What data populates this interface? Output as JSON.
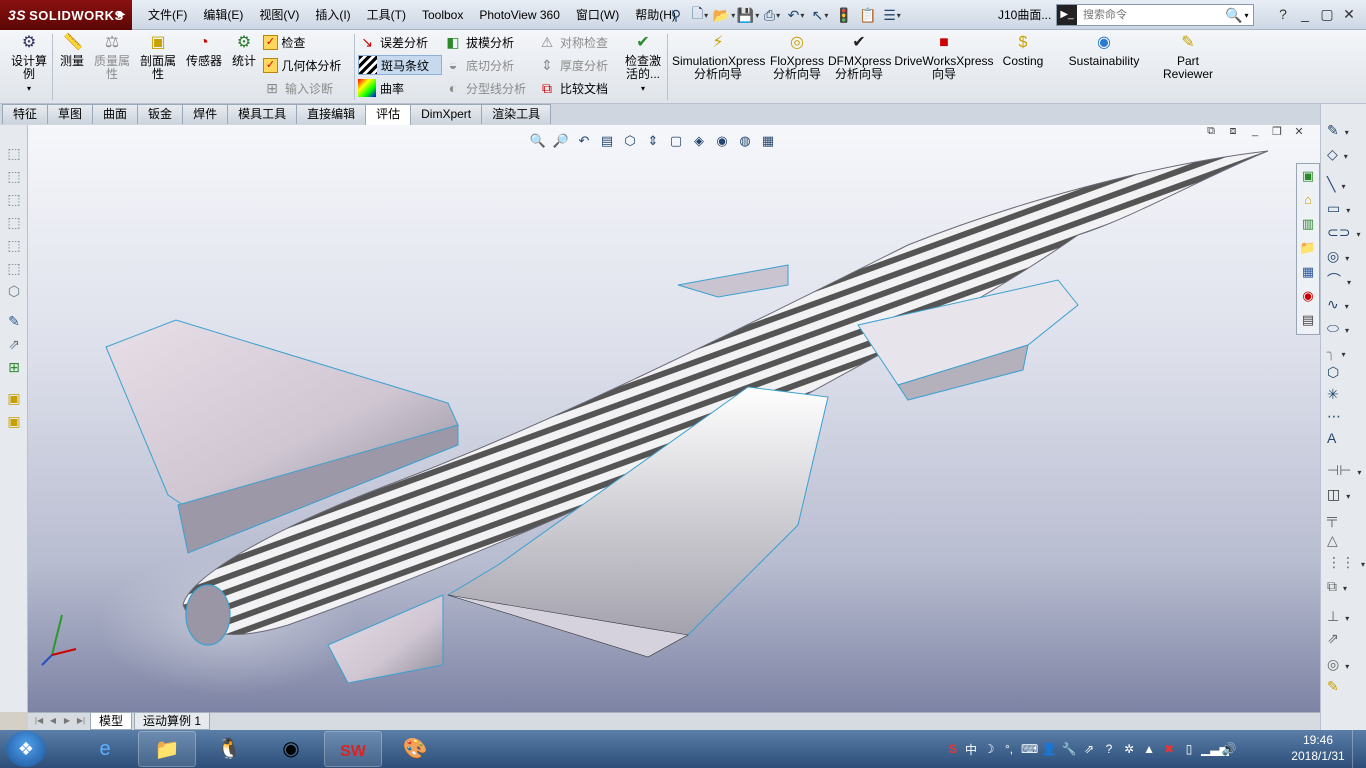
{
  "app": {
    "logo": "SOLIDWORKS",
    "logo_prefix": "3S",
    "menus": [
      "文件(F)",
      "编辑(E)",
      "视图(V)",
      "插入(I)",
      "工具(T)",
      "Toolbox",
      "PhotoView 360",
      "窗口(W)",
      "帮助(H)"
    ],
    "doc_title": "J10曲面...",
    "search_placeholder": "搜索命令",
    "window_controls": [
      "?",
      "_",
      "▢",
      "✕"
    ]
  },
  "ribbon": {
    "design_study": "设计算例",
    "measure": "测量",
    "mass_props": "质量属性",
    "section_props": "剖面属性",
    "sensor": "传感器",
    "statistics": "统计",
    "check": "检查",
    "geometry_analysis": "几何体分析",
    "import_diagnosis": "输入诊断",
    "deviation": "误差分析",
    "zebra": "斑马条纹",
    "curvature": "曲率",
    "draft": "拔模分析",
    "undercut": "底切分析",
    "parting_line": "分型线分析",
    "symmetry": "对称检查",
    "thickness": "厚度分析",
    "compare": "比较文档",
    "check_active": "检查激活的...",
    "simulation_xpress": [
      "SimulationXpress",
      "分析向导"
    ],
    "flo_xpress": [
      "FloXpress",
      "分析向导"
    ],
    "dfm_xpress": [
      "DFMXpress",
      "分析向导"
    ],
    "driveworks": [
      "DriveWorksXpress",
      "向导"
    ],
    "costing": "Costing",
    "sustainability": "Sustainability",
    "part_reviewer": [
      "Part",
      "Reviewer"
    ]
  },
  "tabs": [
    "特征",
    "草图",
    "曲面",
    "钣金",
    "焊件",
    "模具工具",
    "直接编辑",
    "评估",
    "DimXpert",
    "渲染工具"
  ],
  "active_tab": "评估",
  "model_tabs": [
    "模型",
    "运动算例 1"
  ],
  "taskbar": {
    "time": "19:46",
    "date": "2018/1/31",
    "ime": "中"
  },
  "colors": {
    "accent": "#8b1111",
    "viewport_top": "#f6f7fb",
    "viewport_bottom": "#7d83a4"
  }
}
